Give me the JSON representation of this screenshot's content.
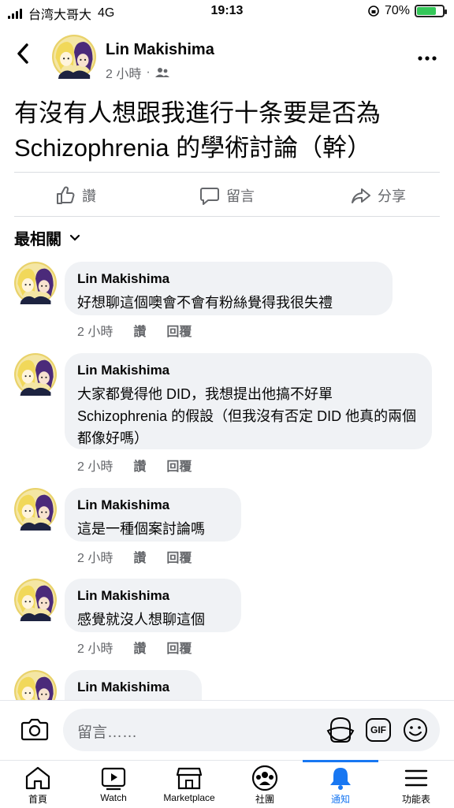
{
  "status_bar": {
    "carrier": "台湾大哥大",
    "network": "4G",
    "time": "19:13",
    "battery": "70%"
  },
  "header": {
    "name": "Lin Makishima",
    "time": "2 小時",
    "separator": "·"
  },
  "post": {
    "text": "有沒有人想跟我進行十条要是否為 Schizophrenia 的學術討論（幹）"
  },
  "actions": {
    "like": "讚",
    "comment": "留言",
    "share": "分享"
  },
  "sort": {
    "label": "最相關"
  },
  "comments": [
    {
      "name": "Lin Makishima",
      "text": "好想聊這個噢會不會有粉絲覺得我很失禮",
      "time": "2 小時",
      "like": "讚",
      "reply": "回覆"
    },
    {
      "name": "Lin Makishima",
      "text": "大家都覺得他 DID，我想提出他搞不好單 Schizophrenia 的假設（但我沒有否定 DID 他真的兩個都像好嗎）",
      "time": "2 小時",
      "like": "讚",
      "reply": "回覆"
    },
    {
      "name": "Lin Makishima",
      "text": "這是一種個案討論嗎",
      "time": "2 小時",
      "like": "讚",
      "reply": "回覆"
    },
    {
      "name": "Lin Makishima",
      "text": "感覺就沒人想聊這個",
      "time": "2 小時",
      "like": "讚",
      "reply": "回覆"
    },
    {
      "name": "Lin Makishima"
    }
  ],
  "composer": {
    "placeholder": "留言……",
    "gif": "GIF"
  },
  "tabs": [
    {
      "label": "首頁"
    },
    {
      "label": "Watch"
    },
    {
      "label": "Marketplace"
    },
    {
      "label": "社團"
    },
    {
      "label": "通知"
    },
    {
      "label": "功能表"
    }
  ],
  "colors": {
    "accent": "#1877f2",
    "bubble": "#f0f2f5",
    "secondary_text": "#65676b"
  }
}
